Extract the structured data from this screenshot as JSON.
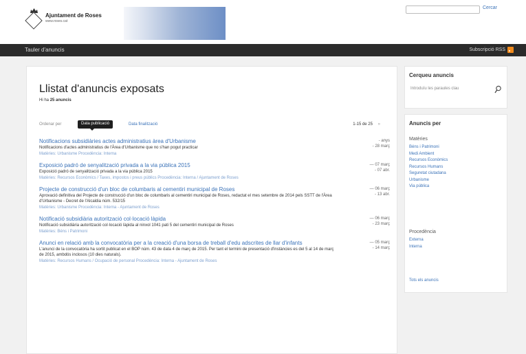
{
  "header": {
    "logo_name": "Ajuntament de Roses",
    "logo_url": "www.roses.cat",
    "search_button": "Cercar"
  },
  "navbar": {
    "title": "Tauler d'anuncis",
    "rss_label": "Subscripció RSS"
  },
  "main": {
    "title": "Llistat d'anuncis exposats",
    "count_prefix": "Hi ha",
    "count_value": "25 anuncis",
    "sort_label": "Ordenar per",
    "sort_active": "Data publicació",
    "sort_alt": "Data finalització",
    "pager": "1-15 de 25",
    "pager_next": "»",
    "items": [
      {
        "title": "Notificacions subsidiàries actes administratius àrea d'Urbanisme",
        "desc": "Notificacions d'actes administratius de l'Àrea d'Urbanisme que no s'han pogut practicar",
        "meta": "Matèries: Urbanisme Procedència: Interna",
        "date1": "- anys",
        "date2": "- 28 març"
      },
      {
        "title": "Exposició padró de senyalització privada a la via pública 2015",
        "desc": "Exposició padró de senyalització privada a la via pública 2015",
        "meta": "Matèries: Recursos Econòmics / Taxes, impostos i preus públics Procedència: Interna / Ajuntament de Roses",
        "date1": "— 07 març",
        "date2": "- 07 abr."
      },
      {
        "title": "Projecte de construcció d'un bloc de columbaris al cementiri municipal de Roses",
        "desc": "Aprovació definitiva del Projecte de construcció d'un bloc de columbaris al cementiri municipal de Roses, redactat el mes setembre de 2014 pels SSTT de l'Àrea d'Urbanisme - Decret de l'Alcaldia núm. 532/15",
        "meta": "Matèries: Urbanisme Procedència: Interna - Ajuntament de Roses",
        "date1": "— 06 març",
        "date2": "- 13 abr."
      },
      {
        "title": "Notificació subsidiària autorització col·locació làpida",
        "desc": "Notificació subsidiària autorització col·locació làpida al ninxol 1041 pati 5 del cementiri municipal de Roses",
        "meta": "Matèries: Béns i Patrimoni",
        "date1": "— 06 març",
        "date2": "- 23 març"
      },
      {
        "title": "Anunci en relació amb la convocatòria per a la creació d'una borsa de treball d'edu adscrites de llar d'infants",
        "desc": "L'anunci de la convocatòria ha sortit publicat en el BOP núm. 43 de data 4 de març de 2015. Per tant el termini de presentació d'instàncies es del 5 al 14 de març de 2015, ambdós inclosos (10 dies naturals).",
        "meta": "Matèries: Recursos Humans / Ocupació de personal Procedència: Interna - Ajuntament de Roses",
        "date1": "— 05 març",
        "date2": "- 14 març"
      }
    ]
  },
  "sidebar": {
    "search_title": "Cerqueu anuncis",
    "search_placeholder": "Introduïu les paraules clau",
    "filter_title": "Anuncis per",
    "materies_title": "Matèries",
    "materies": [
      "Béns i Patrimoni",
      "Medi Ambient",
      "Recursos Econòmics",
      "Recursos Humans",
      "Seguretat ciutadana",
      "Urbanisme",
      "Via pública"
    ],
    "procedencia_title": "Procedència",
    "procedencia": [
      "Externa",
      "Interna"
    ],
    "all_link": "Tots els anuncis"
  },
  "colors": {
    "accent": "#3a72b8",
    "navbar": "#2b2b2b",
    "rss": "#f08a1c"
  }
}
